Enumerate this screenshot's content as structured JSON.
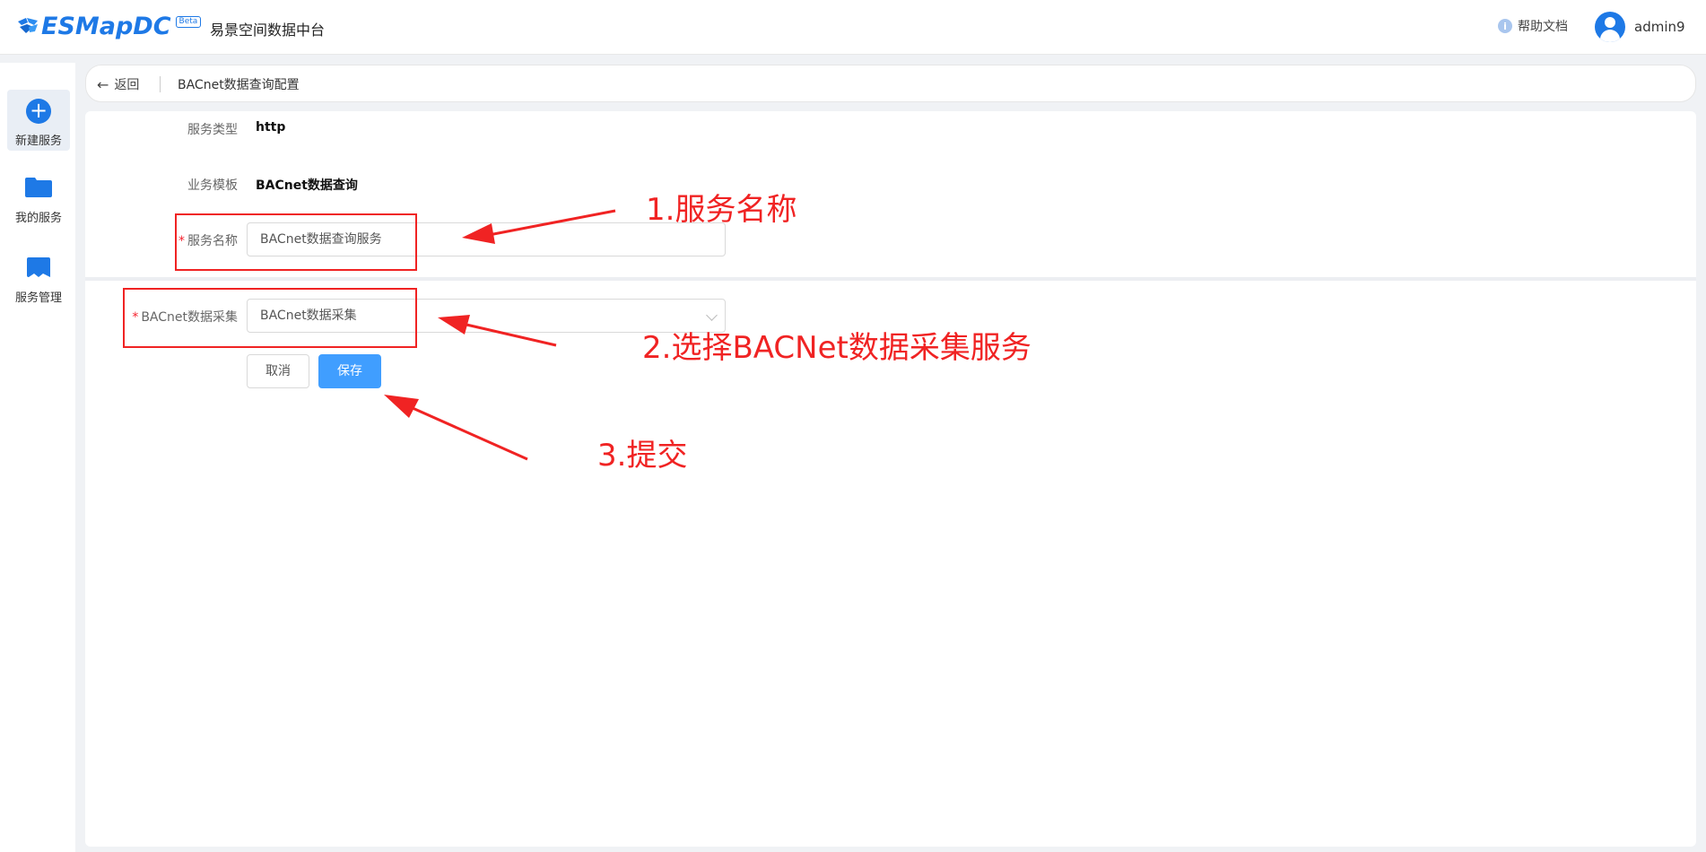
{
  "header": {
    "logo_text": "ESMapDC",
    "beta_badge": "Beta",
    "platform_name": "易景空间数据中台",
    "help_icon_glyph": "i",
    "help_label": "帮助文档",
    "username": "admin9"
  },
  "sidebar": {
    "items": [
      {
        "label": "新建服务",
        "icon": "plus-circle-icon",
        "active": true
      },
      {
        "label": "我的服务",
        "icon": "folder-icon",
        "active": false
      },
      {
        "label": "服务管理",
        "icon": "bookmark-icon",
        "active": false
      }
    ]
  },
  "breadcrumb": {
    "back_label": "返回",
    "title": "BACnet数据查询配置"
  },
  "form": {
    "service_type": {
      "label": "服务类型",
      "value": "http"
    },
    "business_template": {
      "label": "业务模板",
      "value": "BACnet数据查询"
    },
    "service_name": {
      "required_mark": "*",
      "label": "服务名称",
      "value": "BACnet数据查询服务"
    },
    "bacnet_collect": {
      "required_mark": "*",
      "label": "BACnet数据采集",
      "value": "BACnet数据采集"
    },
    "cancel_label": "取消",
    "save_label": "保存"
  },
  "annotations": {
    "step1": "1.服务名称",
    "step2": "2.选择BACNet数据采集服务",
    "step3": "3.提交",
    "color": "#f02323"
  },
  "colors": {
    "brand": "#1e79e6",
    "primary_button": "#409eff",
    "required": "#f5222d"
  }
}
